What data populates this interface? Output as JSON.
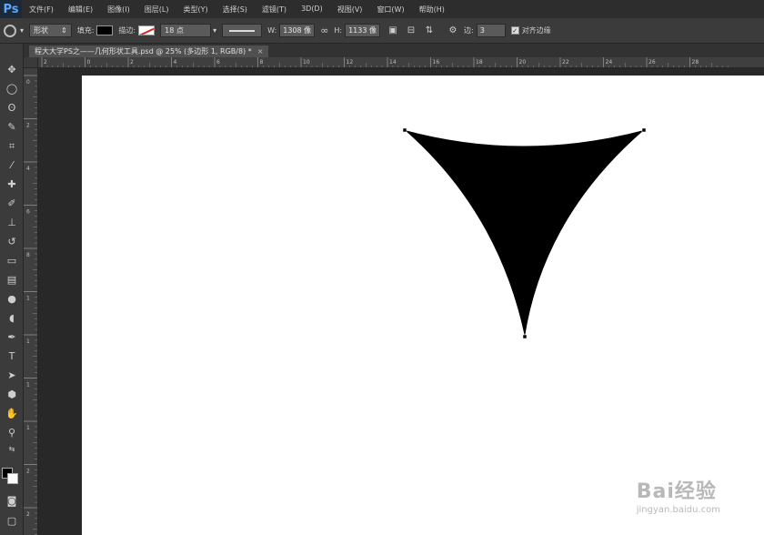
{
  "app": {
    "logo": "Ps"
  },
  "menu": [
    "文件(F)",
    "编辑(E)",
    "图像(I)",
    "图层(L)",
    "类型(Y)",
    "选择(S)",
    "滤镜(T)",
    "3D(D)",
    "视图(V)",
    "窗口(W)",
    "帮助(H)"
  ],
  "options": {
    "mode": "形状",
    "fill_label": "填充:",
    "stroke_label": "描边:",
    "stroke_size": "18 点",
    "w_label": "W:",
    "w_value": "1308 像",
    "h_label": "H:",
    "h_value": "1133 像",
    "sides_label": "边:",
    "sides_value": "3",
    "align_edges": "对齐边缘"
  },
  "document": {
    "tab_title": "程大大学PS之——几何形状工具.psd @ 25% (多边形 1, RGB/8) *",
    "close": "×"
  },
  "ruler_top_labels": [
    "2",
    "0",
    "2",
    "4",
    "6",
    "8",
    "10",
    "12",
    "14",
    "16",
    "18",
    "20",
    "22",
    "24",
    "26",
    "28"
  ],
  "ruler_left_labels": [
    "0",
    "2",
    "4",
    "6",
    "8",
    "1",
    "1",
    "1",
    "1",
    "2",
    "2"
  ],
  "shape": {
    "fill": "#000000",
    "type": "polygon",
    "sides": 3
  },
  "colors": {
    "foreground": "#000000",
    "background": "#ffffff"
  },
  "watermark": {
    "brand": "Bai经验",
    "domain": "jingyan.baidu.com"
  }
}
